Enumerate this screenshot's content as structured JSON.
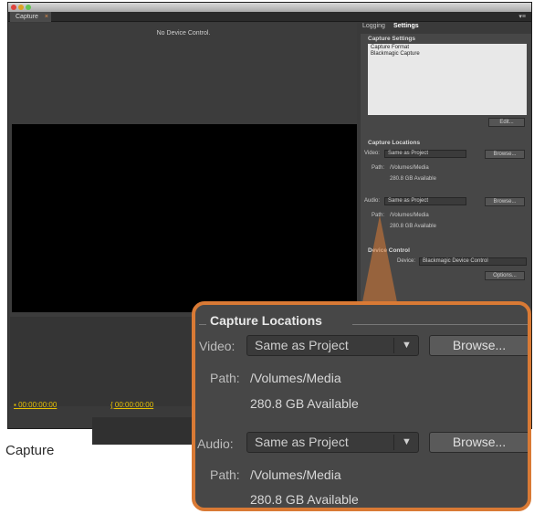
{
  "tabs": {
    "capture": "Capture"
  },
  "monitor": {
    "device_status": "No Device Control.",
    "timecode_in": "00:00:00:00",
    "timecode_out": "00:00:00:00"
  },
  "side_tabs": {
    "logging": "Logging",
    "settings": "Settings"
  },
  "settings": {
    "capture_settings": {
      "title": "Capture Settings",
      "format_label": "Capture Format",
      "format_value": "Blackmagic Capture",
      "edit_button": "Edit..."
    },
    "capture_locations": {
      "title": "Capture Locations",
      "video_label": "Video:",
      "video_value": "Same as Project",
      "browse_label": "Browse...",
      "path_label": "Path:",
      "video_path": "/Volumes/Media",
      "video_available": "280.8 GB Available",
      "audio_label": "Audio:",
      "audio_value": "Same as Project",
      "audio_path": "/Volumes/Media",
      "audio_available": "280.8 GB Available"
    },
    "device_control": {
      "title": "Device Control",
      "device_label": "Device:",
      "device_value": "Blackmagic Device Control",
      "options_button": "Options..."
    }
  },
  "caption": "Capture",
  "callout": {
    "title": "Capture Locations",
    "video_label": "Video:",
    "video_value": "Same as Project",
    "browse_label": "Browse...",
    "path_label": "Path:",
    "video_path": "/Volumes/Media",
    "video_available": "280.8 GB Available",
    "audio_label": "Audio:",
    "audio_value": "Same as Project",
    "audio_path": "/Volumes/Media",
    "audio_available": "280.8 GB Available"
  },
  "colors": {
    "accent": "#d97a35",
    "timecode": "#e8c200"
  }
}
